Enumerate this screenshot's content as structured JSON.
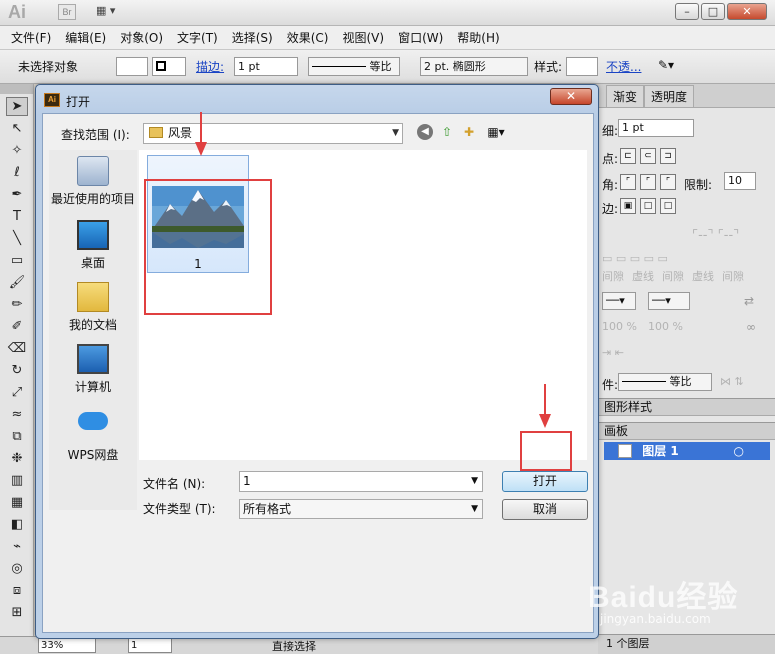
{
  "app": {
    "logo": "Ai",
    "bridge_label": "Br",
    "menu": [
      "文件(F)",
      "编辑(E)",
      "对象(O)",
      "文字(T)",
      "选择(S)",
      "效果(C)",
      "视图(V)",
      "窗口(W)",
      "帮助(H)"
    ]
  },
  "control_bar": {
    "no_selection": "未选择对象",
    "stroke_label": "描边:",
    "stroke_weight": "1 pt",
    "profile": "等比",
    "brush": "2 pt. 椭圆形",
    "style_label": "样式:",
    "opacity_link": "不透..."
  },
  "right_panel": {
    "tabs": [
      "渐变",
      "透明度"
    ],
    "weight_value": "1 pt",
    "limit_label": "限制:",
    "limit_value": "10",
    "dash_labels": [
      "间隙",
      "虚线",
      "间隙",
      "虚线",
      "间隙"
    ],
    "scale_a": "100",
    "scale_b": "100",
    "profile_label": "等比",
    "graphic_styles": "图形样式",
    "artboards": "画板",
    "layer_name": "图层 1",
    "layers_count": "1 个图层"
  },
  "status_bar": {
    "zoom": "33%",
    "page": "1",
    "tool_name": "直接选择"
  },
  "dialog": {
    "title": "打开",
    "close_label": "✕",
    "look_in_label": "查找范围 (I):",
    "look_in_value": "风景",
    "places": [
      "最近使用的项目",
      "桌面",
      "我的文档",
      "计算机",
      "WPS网盘"
    ],
    "files": [
      {
        "name": "1"
      }
    ],
    "filename_label": "文件名 (N):",
    "filename_value": "1",
    "filetype_label": "文件类型 (T):",
    "filetype_value": "所有格式",
    "open_button": "打开",
    "cancel_button": "取消"
  },
  "watermark": {
    "brand": "Baidu经验",
    "url": "jingyan.baidu.com"
  },
  "colors": {
    "accent": "#3a74d6",
    "highlight": "#e04040"
  }
}
